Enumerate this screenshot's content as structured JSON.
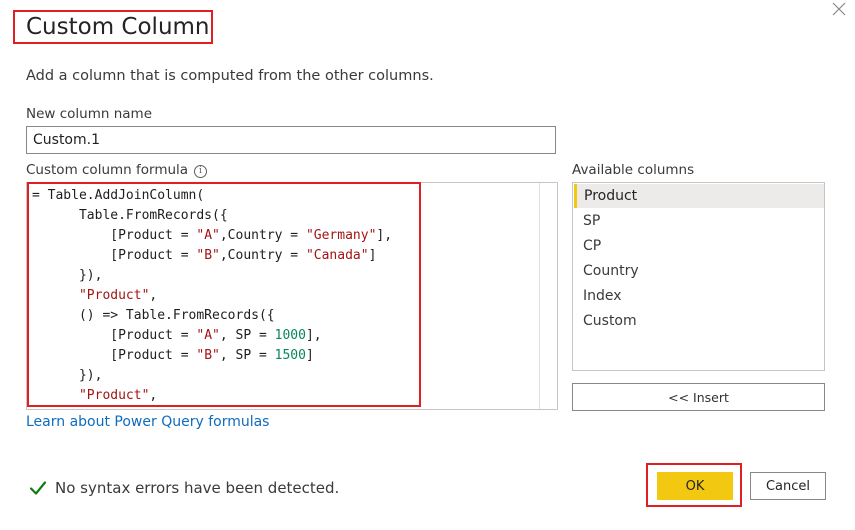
{
  "dialog": {
    "title": "Custom Column",
    "description": "Add a column that is computed from the other columns."
  },
  "name_field": {
    "label": "New column name",
    "value": "Custom.1"
  },
  "formula": {
    "label": "Custom column formula",
    "lines": [
      [
        {
          "t": "= Table.AddJoinColumn("
        }
      ],
      [
        {
          "t": "      Table.FromRecords({"
        }
      ],
      [
        {
          "t": "          [Product = "
        },
        {
          "t": "\"A\"",
          "k": "str"
        },
        {
          "t": ",Country = "
        },
        {
          "t": "\"Germany\"",
          "k": "str"
        },
        {
          "t": "],"
        }
      ],
      [
        {
          "t": "          [Product = "
        },
        {
          "t": "\"B\"",
          "k": "str"
        },
        {
          "t": ",Country = "
        },
        {
          "t": "\"Canada\"",
          "k": "str"
        },
        {
          "t": "]"
        }
      ],
      [
        {
          "t": "      }),"
        }
      ],
      [
        {
          "t": "      "
        },
        {
          "t": "\"Product\"",
          "k": "str"
        },
        {
          "t": ","
        }
      ],
      [
        {
          "t": "      () => Table.FromRecords({"
        }
      ],
      [
        {
          "t": "          [Product = "
        },
        {
          "t": "\"A\"",
          "k": "str"
        },
        {
          "t": ", SP = "
        },
        {
          "t": "1000",
          "k": "num"
        },
        {
          "t": "],"
        }
      ],
      [
        {
          "t": "          [Product = "
        },
        {
          "t": "\"B\"",
          "k": "str"
        },
        {
          "t": ", SP = "
        },
        {
          "t": "1500",
          "k": "num"
        },
        {
          "t": "]"
        }
      ],
      [
        {
          "t": "      }),"
        }
      ],
      [
        {
          "t": "      "
        },
        {
          "t": "\"Product\"",
          "k": "str"
        },
        {
          "t": ","
        }
      ]
    ],
    "learn_link": "Learn about Power Query formulas"
  },
  "available_columns": {
    "label": "Available columns",
    "items": [
      "Product",
      "SP",
      "CP",
      "Country",
      "Index",
      "Custom"
    ],
    "selected": "Product",
    "insert_label": "<< Insert"
  },
  "status": {
    "text": "No syntax errors have been detected."
  },
  "buttons": {
    "ok": "OK",
    "cancel": "Cancel"
  },
  "colors": {
    "accent": "#f2c811",
    "annotation": "#e02020",
    "link": "#0f6cbd",
    "success": "#107c10",
    "string": "#a31515",
    "number": "#098658"
  },
  "icons": {
    "close": "close-icon",
    "info": "info-icon",
    "check": "checkmark-icon"
  }
}
